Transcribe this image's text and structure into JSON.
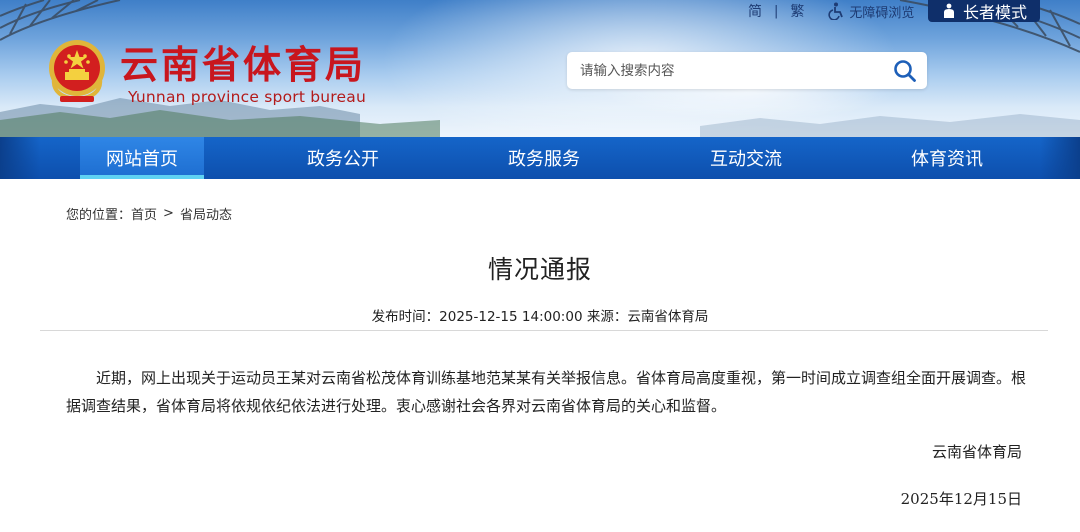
{
  "utility": {
    "simplified": "简",
    "separator": "|",
    "traditional": "繁",
    "accessibility": "无障碍浏览",
    "elder_mode": "长者模式"
  },
  "header": {
    "title": "云南省体育局",
    "subtitle": "Yunnan province sport bureau"
  },
  "search": {
    "placeholder": "请输入搜索内容"
  },
  "nav": {
    "items": [
      {
        "label": "网站首页"
      },
      {
        "label": "政务公开"
      },
      {
        "label": "政务服务"
      },
      {
        "label": "互动交流"
      },
      {
        "label": "体育资讯"
      }
    ]
  },
  "breadcrumb": {
    "prefix": "您的位置：",
    "home": "首页",
    "arrow": ">",
    "current": "省局动态"
  },
  "article": {
    "title": "情况通报",
    "meta": "发布时间：2025-12-15 14:00:00 来源：云南省体育局",
    "body": "近期，网上出现关于运动员王某对云南省松茂体育训练基地范某某有关举报信息。省体育局高度重视，第一时间成立调查组全面开展调查。根据调查结果，省体育局将依规依纪依法进行处理。衷心感谢社会各界对云南省体育局的关心和监督。",
    "signature": "云南省体育局",
    "date": "2025年12月15日"
  },
  "colors": {
    "title_red": "#c8161e",
    "nav_blue": "#0d4fad",
    "nav_active": "#2f86e6",
    "active_underline": "#5fd2f2",
    "elder_bg": "#0f2f6a"
  }
}
